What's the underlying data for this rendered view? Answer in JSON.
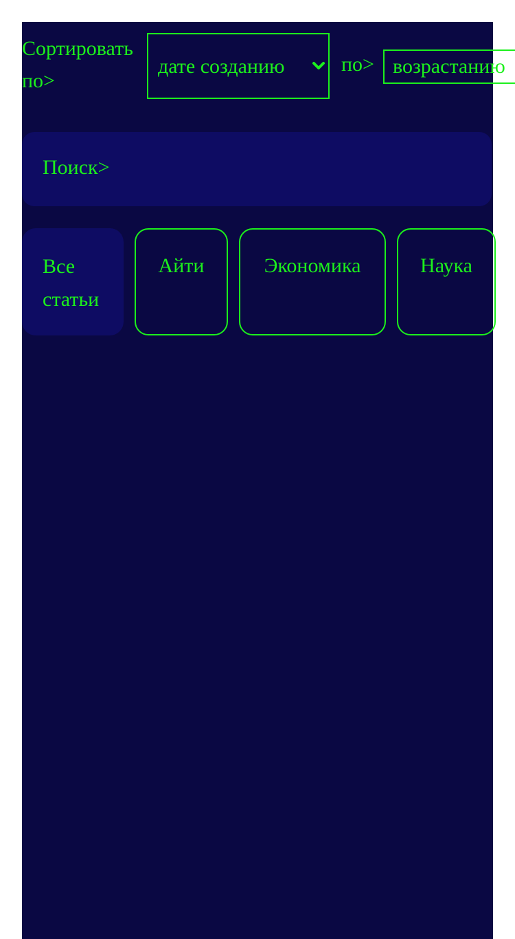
{
  "sort": {
    "label": "Сортировать по>",
    "field_value": "дате созданию",
    "order_label": "по>",
    "order_value": "возрастанию"
  },
  "search": {
    "placeholder": "Поиск>"
  },
  "tabs": [
    {
      "label": "Все статьи",
      "active": true
    },
    {
      "label": "Айти",
      "active": false
    },
    {
      "label": "Экономика",
      "active": false
    },
    {
      "label": "Наука",
      "active": false
    }
  ],
  "colors": {
    "background": "#0a0843",
    "panel": "#0e0c63",
    "accent": "#1cf01c",
    "outer": "#ffffff"
  },
  "icons": {
    "sort_field_dropdown": "chevron-down-icon"
  }
}
